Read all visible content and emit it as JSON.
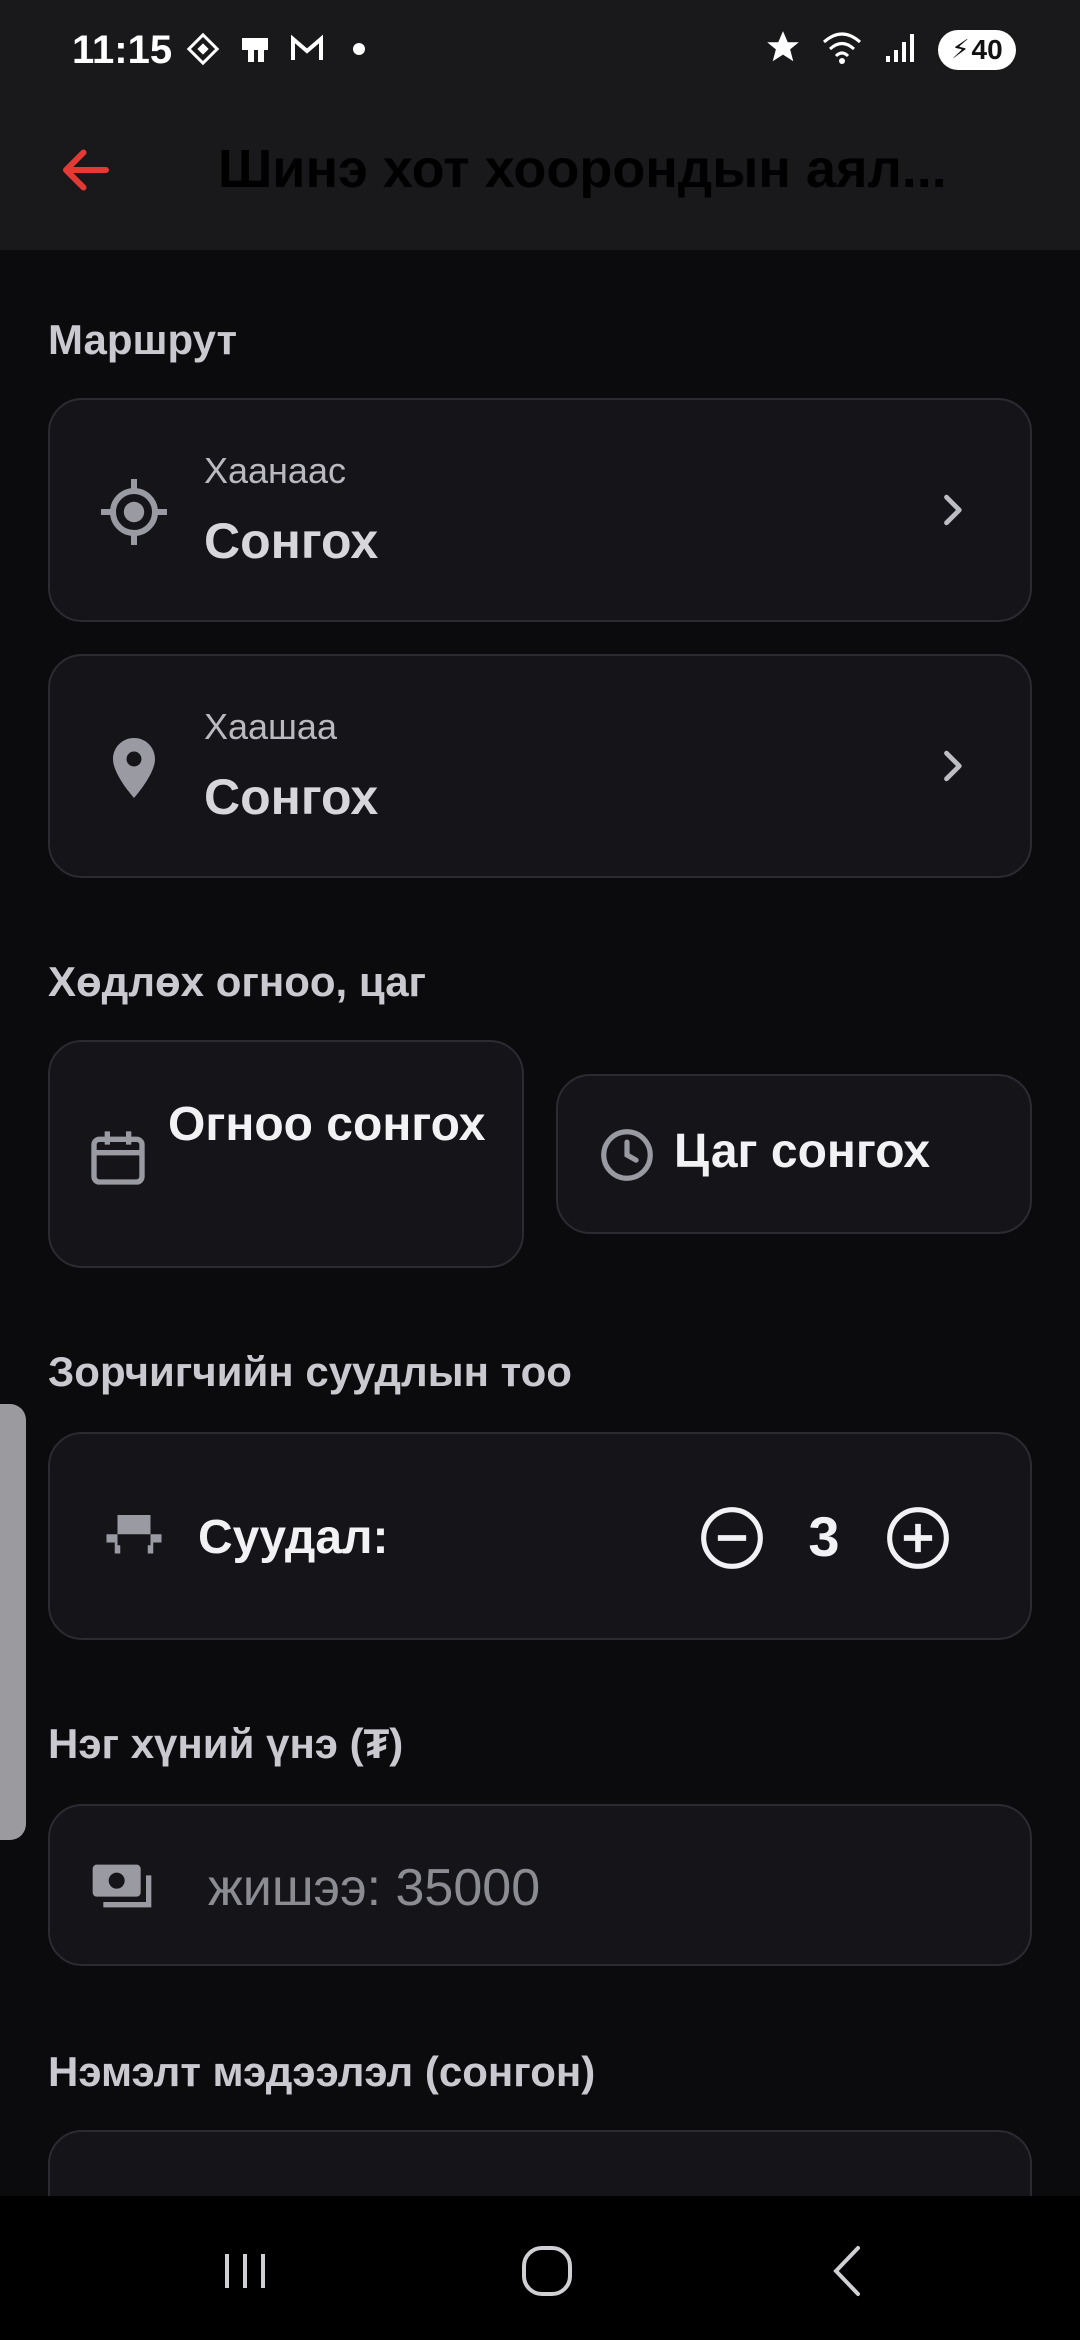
{
  "status_bar": {
    "time": "11:15",
    "notification_icons": [
      "diamond-icon",
      "sim-icon",
      "gmail-icon",
      "dot-icon"
    ],
    "right_icons": [
      "star-icon",
      "wifi-icon",
      "signal-icon"
    ],
    "battery": "40"
  },
  "app_bar": {
    "back_icon": "arrow-left-icon",
    "title": "Шинэ хот хоорондын аял..."
  },
  "route": {
    "label": "Маршрут",
    "from": {
      "label": "Хаанаас",
      "value": "Сонгох",
      "icon": "gps-target-icon"
    },
    "to": {
      "label": "Хаашаа",
      "value": "Сонгох",
      "icon": "map-pin-icon"
    }
  },
  "datetime": {
    "label": "Хөдлөх огноо, цаг",
    "date_placeholder": "Огноо сонгох",
    "time_placeholder": "Цаг сонгох"
  },
  "seats": {
    "label": "Зорчигчийн суудлын тоо",
    "field_label": "Суудал:",
    "count": "3"
  },
  "price": {
    "label": "Нэг хүний үнэ (₮)",
    "placeholder": "жишээ: 35000"
  },
  "notes": {
    "label": "Нэмэлт мэдээлэл (сонгон)"
  },
  "colors": {
    "accent": "#e53935",
    "background": "#0b0b0d",
    "card": "#151519"
  }
}
